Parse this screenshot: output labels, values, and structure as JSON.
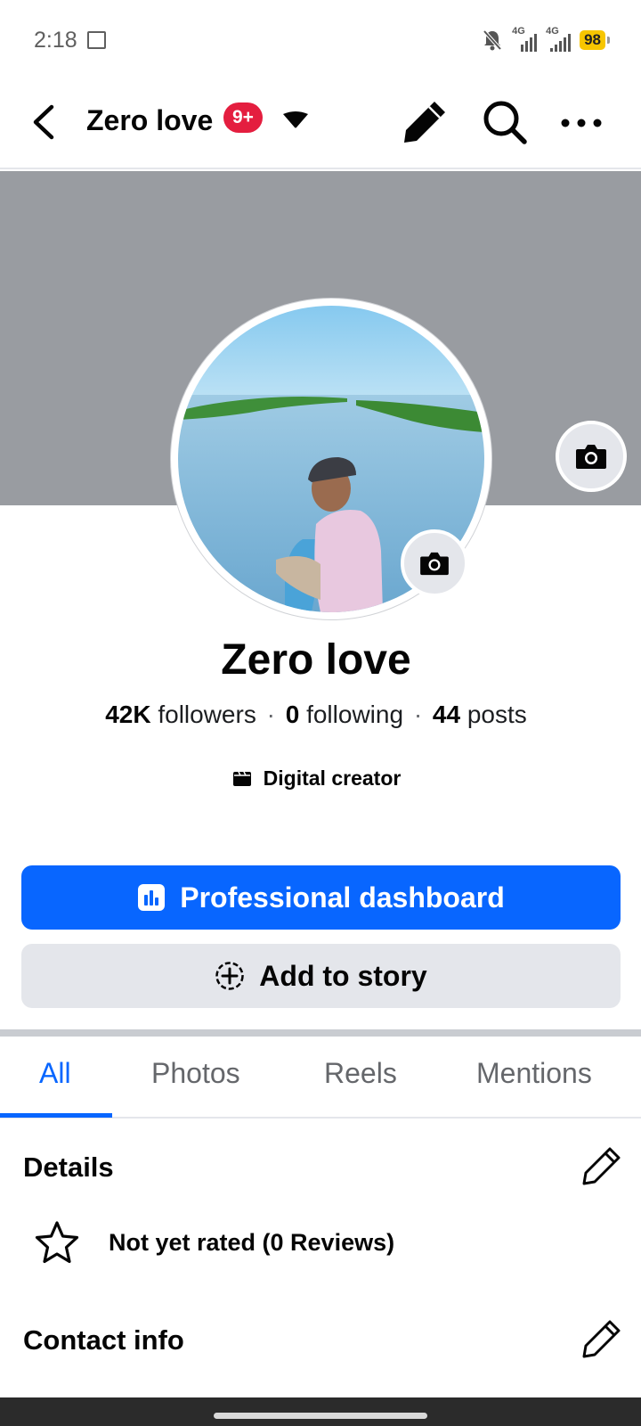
{
  "status_bar": {
    "time": "2:18",
    "network1": "4G",
    "network2": "4G",
    "battery": "98"
  },
  "header": {
    "title": "Zero love",
    "badge": "9+"
  },
  "profile": {
    "name": "Zero love",
    "followers_count": "42K",
    "followers_label": "followers",
    "following_count": "0",
    "following_label": "following",
    "posts_count": "44",
    "posts_label": "posts",
    "separator": "·",
    "category": "Digital creator"
  },
  "actions": {
    "primary_label": "Professional dashboard",
    "secondary_label": "Add to story"
  },
  "tabs": [
    {
      "label": "All",
      "active": true
    },
    {
      "label": "Photos",
      "active": false
    },
    {
      "label": "Reels",
      "active": false
    },
    {
      "label": "Mentions",
      "active": false
    }
  ],
  "details": {
    "title": "Details",
    "rating_text": "Not yet rated (0 Reviews)"
  },
  "contact": {
    "title": "Contact info"
  },
  "colors": {
    "accent": "#0866ff",
    "badge": "#e41e3f",
    "cover": "#999ca1",
    "secondary_button": "#e4e6eb"
  },
  "icons": {
    "back": "chevron-left-icon",
    "caret": "caret-down-icon",
    "edit": "pencil-icon",
    "search": "search-icon",
    "more": "more-dots-icon",
    "camera": "camera-icon",
    "category": "creator-icon",
    "dashboard": "bar-chart-icon",
    "add_story": "plus-circle-icon",
    "rating": "star-icon"
  }
}
